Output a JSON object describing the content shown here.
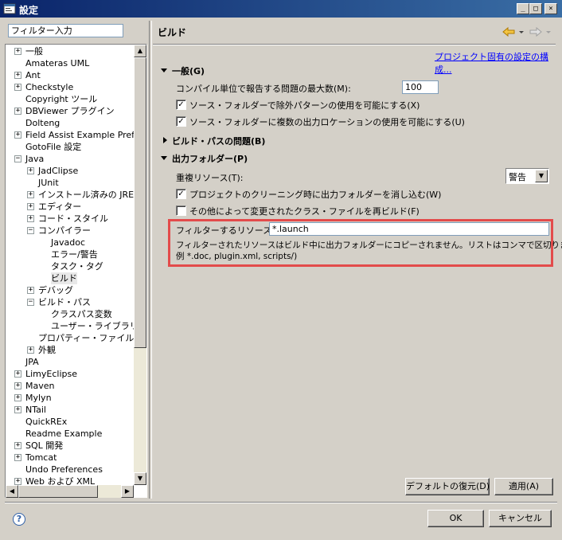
{
  "window": {
    "title": "設定",
    "minimize": "_",
    "maximize": "□",
    "close": "×"
  },
  "filter": {
    "value": "フィルター入力"
  },
  "tree": {
    "items": [
      {
        "label": "一般",
        "expander": "+"
      },
      {
        "label": "Amateras UML",
        "expander": ""
      },
      {
        "label": "Ant",
        "expander": "+"
      },
      {
        "label": "Checkstyle",
        "expander": "+"
      },
      {
        "label": "Copyright ツール",
        "expander": ""
      },
      {
        "label": "DBViewer プラグイン",
        "expander": "+"
      },
      {
        "label": "Dolteng",
        "expander": ""
      },
      {
        "label": "Field Assist Example Prefe",
        "expander": "+"
      },
      {
        "label": "GotoFile 設定",
        "expander": ""
      },
      {
        "label": "Java",
        "expander": "−"
      },
      {
        "label": "JadClipse",
        "expander": "+"
      },
      {
        "label": "JUnit",
        "expander": ""
      },
      {
        "label": "インストール済みの JRE",
        "expander": "+"
      },
      {
        "label": "エディター",
        "expander": "+"
      },
      {
        "label": "コード・スタイル",
        "expander": "+"
      },
      {
        "label": "コンパイラー",
        "expander": "−"
      },
      {
        "label": "Javadoc",
        "expander": ""
      },
      {
        "label": "エラー/警告",
        "expander": ""
      },
      {
        "label": "タスク・タグ",
        "expander": ""
      },
      {
        "label": "ビルド",
        "expander": ""
      },
      {
        "label": "デバッグ",
        "expander": "+"
      },
      {
        "label": "ビルド・パス",
        "expander": "−"
      },
      {
        "label": "クラスパス変数",
        "expander": ""
      },
      {
        "label": "ユーザー・ライブラリー",
        "expander": ""
      },
      {
        "label": "プロパティー・ファイル・エデ",
        "expander": ""
      },
      {
        "label": "外観",
        "expander": "+"
      },
      {
        "label": "JPA",
        "expander": ""
      },
      {
        "label": "LimyEclipse",
        "expander": "+"
      },
      {
        "label": "Maven",
        "expander": "+"
      },
      {
        "label": "Mylyn",
        "expander": "+"
      },
      {
        "label": "NTail",
        "expander": "+"
      },
      {
        "label": "QuickREx",
        "expander": ""
      },
      {
        "label": "Readme Example",
        "expander": ""
      },
      {
        "label": "SQL 開発",
        "expander": "+"
      },
      {
        "label": "Tomcat",
        "expander": "+"
      },
      {
        "label": "Undo Preferences",
        "expander": ""
      },
      {
        "label": "Web および XML",
        "expander": "+"
      }
    ]
  },
  "page": {
    "title": "ビルド",
    "project_link": "プロジェクト固有の設定の構成...",
    "general": {
      "heading": "一般(G)",
      "max_problems_label": "コンパイル単位で報告する問題の最大数(M):",
      "max_problems_value": "100",
      "cb_exclusion_label": "ソース・フォルダーで除外パターンの使用を可能にする(X)",
      "cb_exclusion_checked": "✓",
      "cb_multi_output_label": "ソース・フォルダーに複数の出力ロケーションの使用を可能にする(U)",
      "cb_multi_output_checked": "✓"
    },
    "buildpath_heading": "ビルド・パスの問題(B)",
    "output": {
      "heading": "出力フォルダー(P)",
      "duplicate_label": "重複リソース(T):",
      "duplicate_value": "警告",
      "cb_scrub_label": "プロジェクトのクリーニング時に出力フォルダーを消し込む(W)",
      "cb_scrub_checked": "✓",
      "cb_rebuild_label": "その他によって変更されたクラス・ファイルを再ビルド(F)",
      "cb_rebuild_checked": "",
      "filter_label": "フィルターするリソース(L):",
      "filter_value": "*.launch",
      "filter_help_1": "フィルターされたリソースはビルド中に出力フォルダーにコピーされません。リストはコンマで区切ります。(",
      "filter_help_2": "例 *.doc, plugin.xml, scripts/)"
    },
    "restore_defaults": "デフォルトの復元(D)",
    "apply": "適用(A)"
  },
  "footer": {
    "help": "?",
    "ok": "OK",
    "cancel": "キャンセル"
  },
  "colors": {
    "highlight_box": "#e34b4b",
    "link": "#0000ff",
    "titlebar": "#0a246a"
  }
}
